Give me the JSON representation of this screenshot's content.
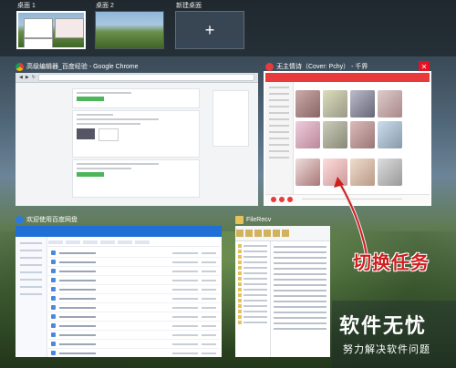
{
  "task_view": {
    "desktops": [
      {
        "label": "桌面 1",
        "active": true
      },
      {
        "label": "桌面 2",
        "active": false
      },
      {
        "label": "新建桌面",
        "icon": "plus-icon"
      }
    ]
  },
  "windows": {
    "chrome": {
      "title": "高级编辑器_百度经验 - Google Chrome",
      "icon": "chrome-icon"
    },
    "music": {
      "title": "无主情诗（Cover: Pchy） - 千界",
      "icon": "netease-music-icon",
      "selected": true
    },
    "baidu_disk": {
      "title": "欢迎使用百度网盘",
      "icon": "baidu-netdisk-icon"
    },
    "file_explorer": {
      "title": "FileRecv",
      "icon": "folder-icon"
    }
  },
  "annotation": {
    "text": "切换任务",
    "color": "#d01e1e"
  },
  "watermark": {
    "title": "软件无忧",
    "subtitle": "努力解决软件问题"
  }
}
